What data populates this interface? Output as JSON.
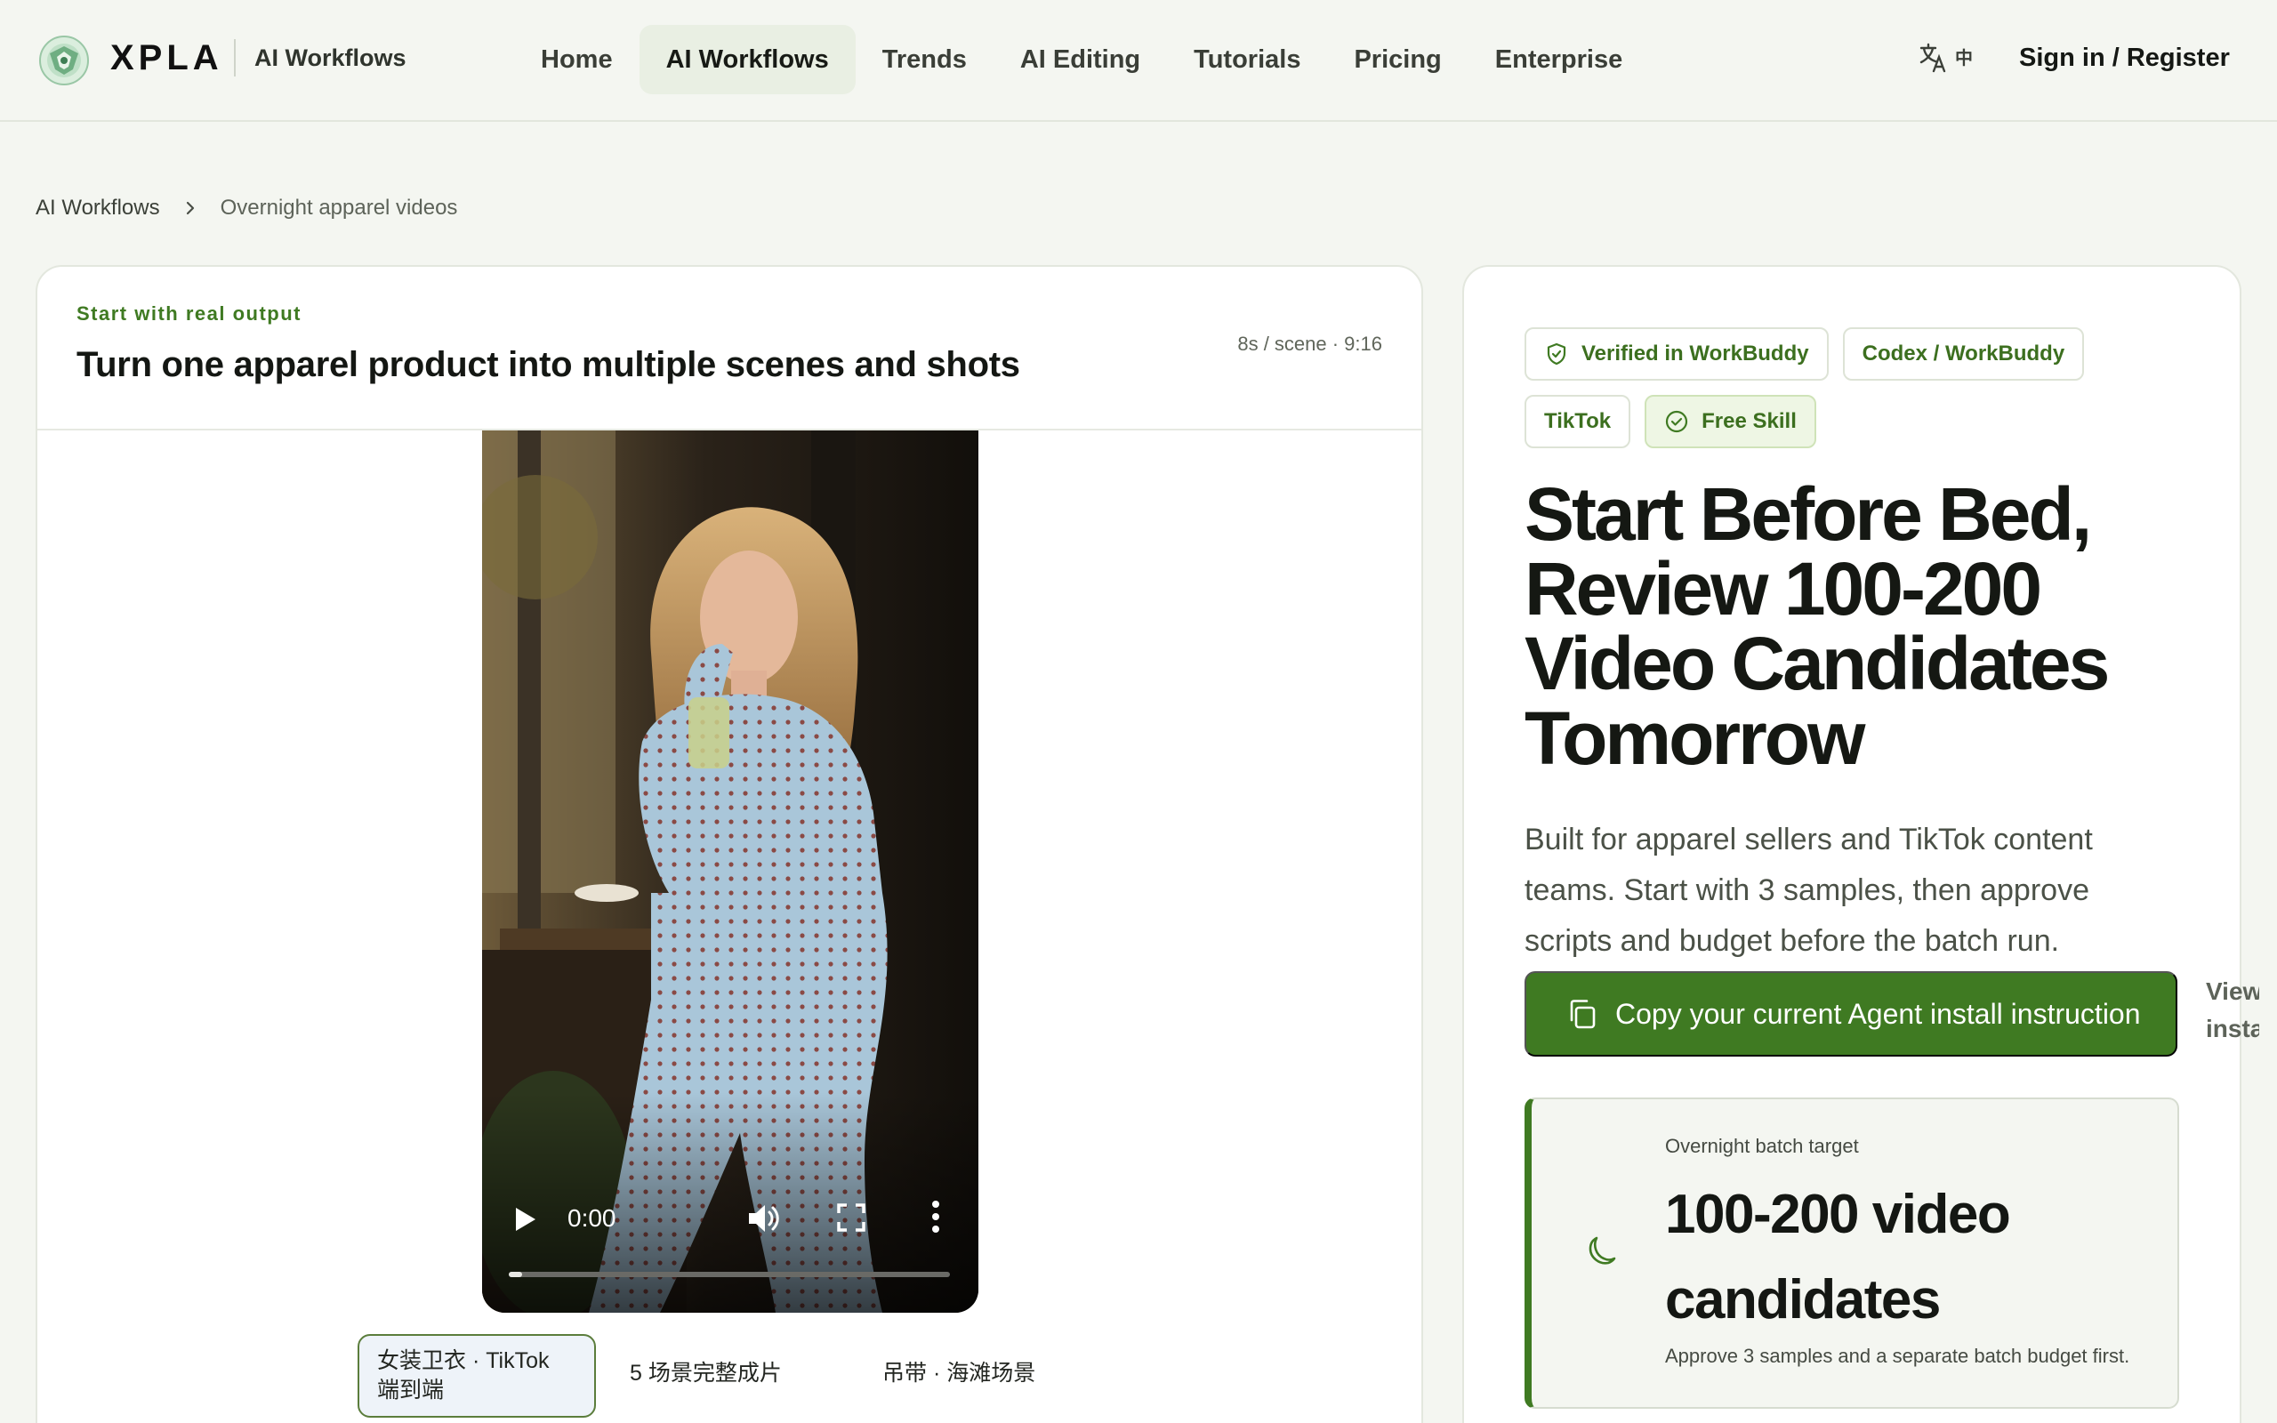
{
  "header": {
    "brand": "XPLA",
    "section": "AI Workflows",
    "nav": [
      "Home",
      "AI Workflows",
      "Trends",
      "AI Editing",
      "Tutorials",
      "Pricing",
      "Enterprise"
    ],
    "active_nav": "AI Workflows",
    "lang_label": "中",
    "signin": "Sign in / Register"
  },
  "breadcrumb": {
    "root": "AI Workflows",
    "current": "Overnight apparel videos"
  },
  "left": {
    "eyebrow": "Start with real output",
    "title": "Turn one apparel product into multiple scenes and shots",
    "meta": "8s / scene · 9:16",
    "video": {
      "time": "0:00",
      "progress": 0.03
    },
    "scene_tabs": [
      {
        "label": "女装卫衣 · TikTok 端到端",
        "active": true
      },
      {
        "label": "5 场景完整成片",
        "active": false
      },
      {
        "label": "吊带 · 海滩场景",
        "active": false
      }
    ]
  },
  "right": {
    "badges": [
      {
        "label": "Verified in WorkBuddy",
        "icon": "shield-check-icon",
        "style": "outline"
      },
      {
        "label": "Codex / WorkBuddy",
        "icon": "",
        "style": "outline"
      },
      {
        "label": "TikTok",
        "icon": "",
        "style": "outline"
      },
      {
        "label": "Free Skill",
        "icon": "check-circle-icon",
        "style": "green"
      }
    ],
    "hero_title": "Start Before Bed, Review 100-200 Video Candidates Tomorrow",
    "hero_sub": "Built for apparel sellers and TikTok content teams. Start with 3 samples, then approve scripts and budget before the batch run.",
    "cta": "Copy your current Agent install instruction",
    "view_install": "View install",
    "target": {
      "label": "Overnight batch target",
      "value": "100-200 video candidates",
      "note": "Approve 3 samples and a separate batch budget first."
    }
  },
  "colors": {
    "accent": "#3f7a22",
    "background": "#f4f6f1",
    "card": "#ffffff"
  }
}
